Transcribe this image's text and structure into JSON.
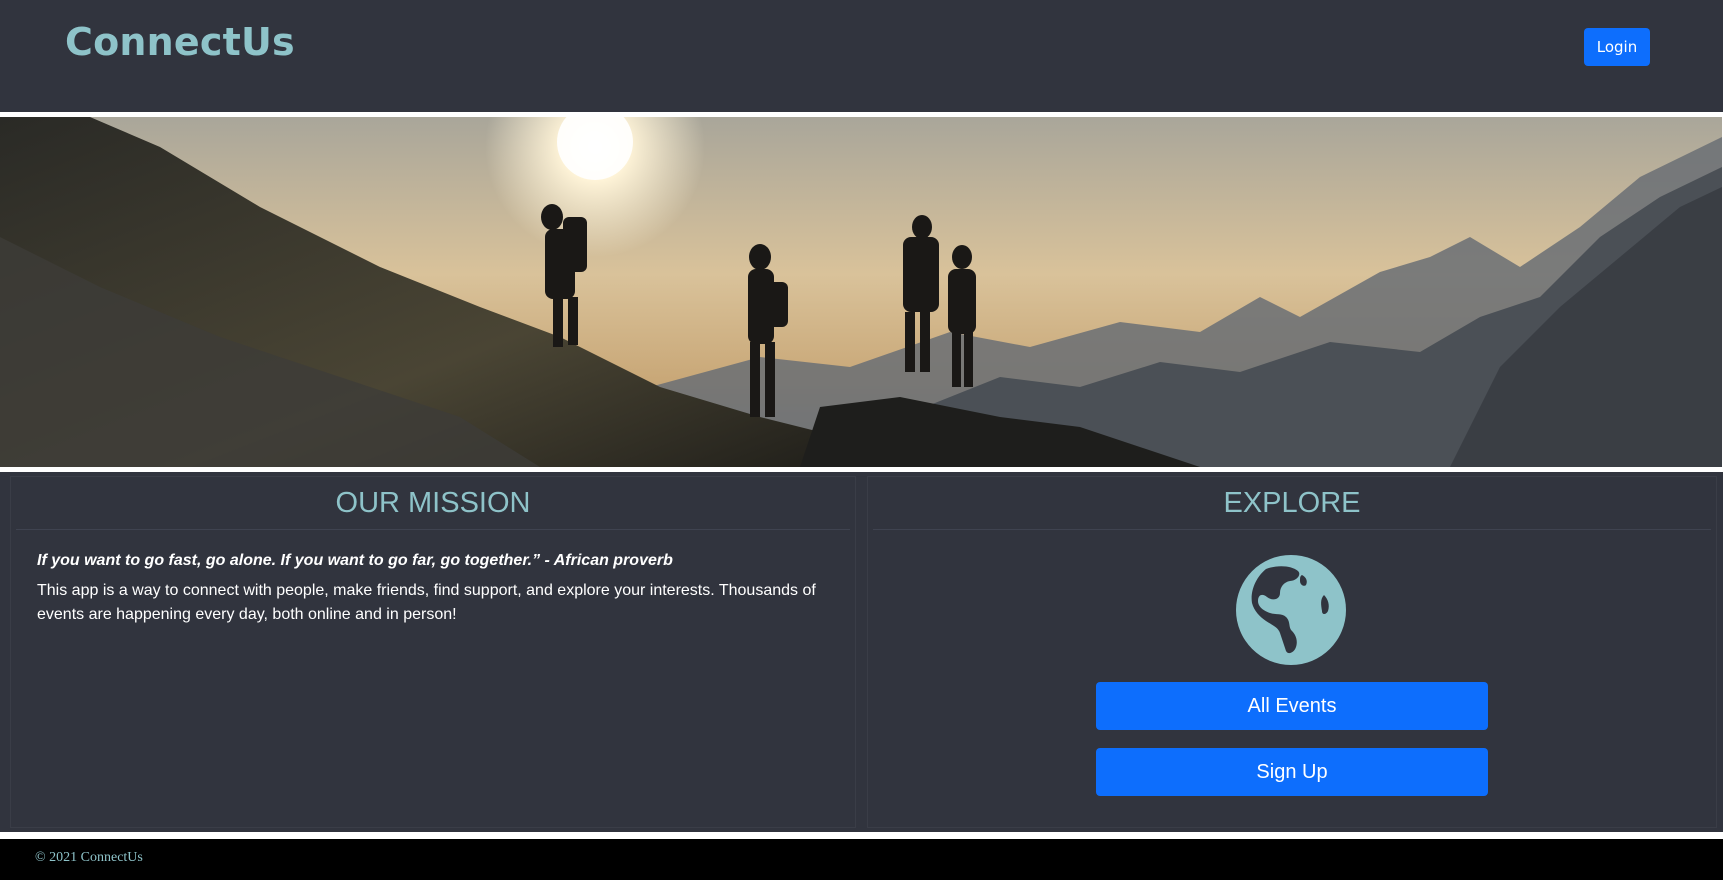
{
  "header": {
    "brand": "ConnectUs",
    "login_label": "Login"
  },
  "hero": {
    "image": "mountain-hikers-sunset-image"
  },
  "mission": {
    "title": "OUR MISSION",
    "quote": "If you want to go fast, go alone. If you want to go far, go together.” - African proverb",
    "description": "This app is a way to connect with people, make friends, find support, and explore your interests. Thousands of events are happening every day, both online and in person!"
  },
  "explore": {
    "title": "EXPLORE",
    "icon": "globe-icon",
    "all_events_label": "All Events",
    "sign_up_label": "Sign Up"
  },
  "footer": {
    "copyright": "© 2021 ConnectUs"
  },
  "colors": {
    "background": "#31343e",
    "accent": "#8ec3c9",
    "button": "#0d6efd",
    "footer": "#000000"
  }
}
